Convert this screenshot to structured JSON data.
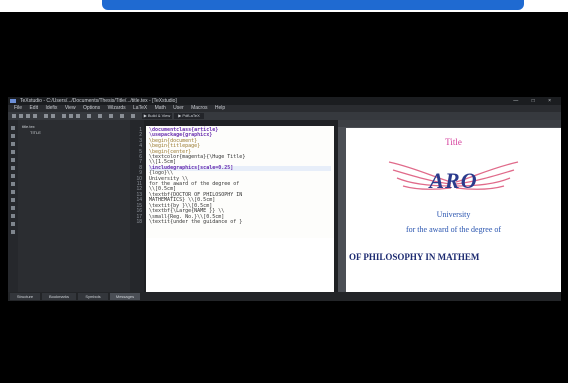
{
  "window": {
    "title": "TeXstudio - C:/Users/.../Documents/Thesis/Title/.../title.tex - [TeXstudio]",
    "controls": "— □ ×"
  },
  "menu": [
    "File",
    "Edit",
    "Idefix",
    "View",
    "Options",
    "Wizards",
    "LaTeX",
    "Math",
    "User",
    "Macros",
    "Help"
  ],
  "toolbar": {
    "run_label": "▶ Build & View",
    "selector_label": "▶ PdfLaTeX"
  },
  "structure": {
    "root": "title.tex",
    "child": "TITLE"
  },
  "editor": {
    "line_numbers": [
      "1",
      "2",
      "3",
      "4",
      "5",
      "6",
      "7",
      "8",
      "9",
      "10",
      "11",
      "12",
      "13",
      "14",
      "15",
      "16",
      "17",
      "18"
    ],
    "code_lines": [
      "\\documentclass{article}",
      "\\usepackage{graphicx}",
      "\\begin{document}",
      "\\begin{titlepage}",
      "\\begin{center}",
      "\\textcolor{magenta}{\\Huge Title}",
      "\\\\[1.5cm]",
      "\\includegraphics[scale=0.25]",
      "{logo}\\\\",
      "University \\\\",
      "for the award of the degree of",
      "\\\\[0.5cm]",
      "\\textbf{DOCTOR OF PHILOSOPHY IN",
      "MATHEMATICS} \\\\[0.5cm]",
      "\\textit{by }\\\\[0.5cm]",
      "\\textbf{\\Large{NAME }} \\\\",
      "\\small{Reg. No.}\\\\[0.5cm]",
      "\\textit{under the guidance of }"
    ]
  },
  "bottom_tabs": [
    "Structure",
    "Bookmarks",
    "Symbols",
    "Messages"
  ],
  "preview": {
    "title": "Title",
    "logo_text": "ARO",
    "university": "University",
    "award": "for the award of the degree of",
    "degree": "OF PHILOSOPHY IN MATHEM",
    "colors": {
      "title": "#d43a9a",
      "logo": "#2a3a8c",
      "wings": "#e06a8a",
      "body": "#2a55b0"
    }
  },
  "video_bar_color": "#1f6ad1"
}
